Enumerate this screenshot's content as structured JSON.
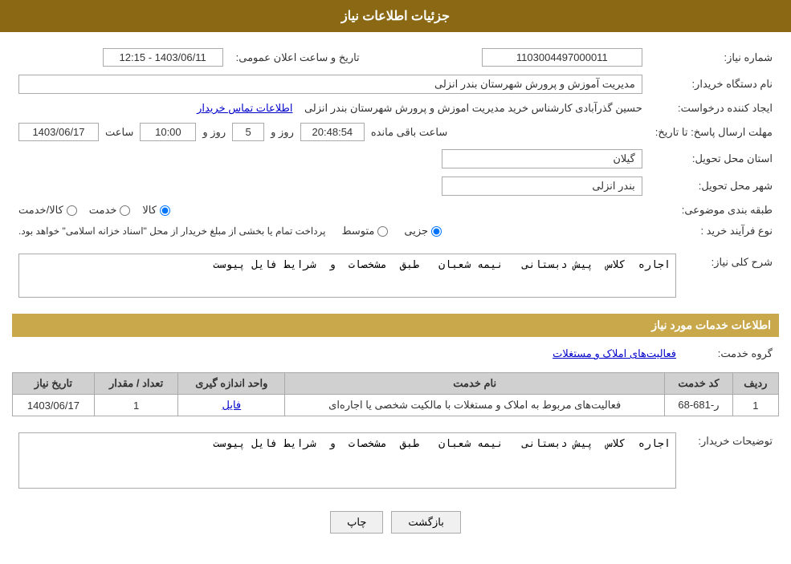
{
  "page": {
    "header": "جزئیات اطلاعات نیاز",
    "sections": {
      "basic_info_title": "",
      "services_info_title": "اطلاعات خدمات مورد نیاز"
    }
  },
  "labels": {
    "need_number": "شماره نیاز:",
    "buyer_org": "نام دستگاه خریدار:",
    "creator": "ایجاد کننده درخواست:",
    "deadline": "مهلت ارسال پاسخ: تا تاریخ:",
    "province": "استان محل تحویل:",
    "city": "شهر محل تحویل:",
    "category": "طبقه بندی موضوعی:",
    "purchase_type": "نوع فرآیند خرید :",
    "need_description": "شرح کلی نیاز:",
    "service_group": "گروه خدمت:",
    "buyer_notes": "توضیحات خریدار:"
  },
  "values": {
    "need_number": "1103004497000011",
    "buyer_org": "مدیریت آموزش و پرورش شهرستان بندر انزلی",
    "creator_name": "حسین گذرآبادی کارشناس خرید مدیریت اموزش و پرورش شهرستان بندر انزلی",
    "creator_link": "اطلاعات تماس خریدار",
    "public_announce_label": "تاریخ و ساعت اعلان عمومی:",
    "public_announce_value": "1403/06/11 - 12:15",
    "deadline_date": "1403/06/17",
    "deadline_time": "10:00",
    "deadline_days": "5",
    "deadline_remaining": "20:48:54",
    "deadline_remaining_label": "روز و",
    "deadline_remaining_suffix": "ساعت باقی مانده",
    "province_value": "گیلان",
    "city_value": "بندر انزلی",
    "category_goods": "کالا",
    "category_service": "خدمت",
    "category_goods_service": "کالا/خدمت",
    "category_selected": "کالا",
    "purchase_type_partial": "جزیی",
    "purchase_type_medium": "متوسط",
    "purchase_type_note": "پرداخت تمام یا بخشی از مبلغ خریدار از محل \"اسناد خزانه اسلامی\" خواهد بود.",
    "need_description_text": "اجاره  کلاس  پیش دبستانی   نیمه شعبان   طبق  مشخصات  و  شرایط فایل پیوست",
    "service_group_value": "فعالیت‌های  املاک  و مستغلات",
    "service_group_link": "فعالیت‌های  املاک  و مستغلات",
    "buyer_notes_text": "اجاره  کلاس  پیش دبستانی   نیمه شعبان   طبق  مشخصات  و  شرایط فایل پیوست"
  },
  "table": {
    "headers": [
      "ردیف",
      "کد خدمت",
      "نام خدمت",
      "واحد اندازه گیری",
      "تعداد / مقدار",
      "تاریخ نیاز"
    ],
    "rows": [
      {
        "row": "1",
        "code": "ر-681-68",
        "name": "فعالیت‌های مربوط به املاک و مستغلات با مالکیت شخصی یا اجاره‌ای",
        "unit": "فایل",
        "quantity": "1",
        "date": "1403/06/17"
      }
    ]
  },
  "buttons": {
    "print": "چاپ",
    "back": "بازگشت"
  }
}
